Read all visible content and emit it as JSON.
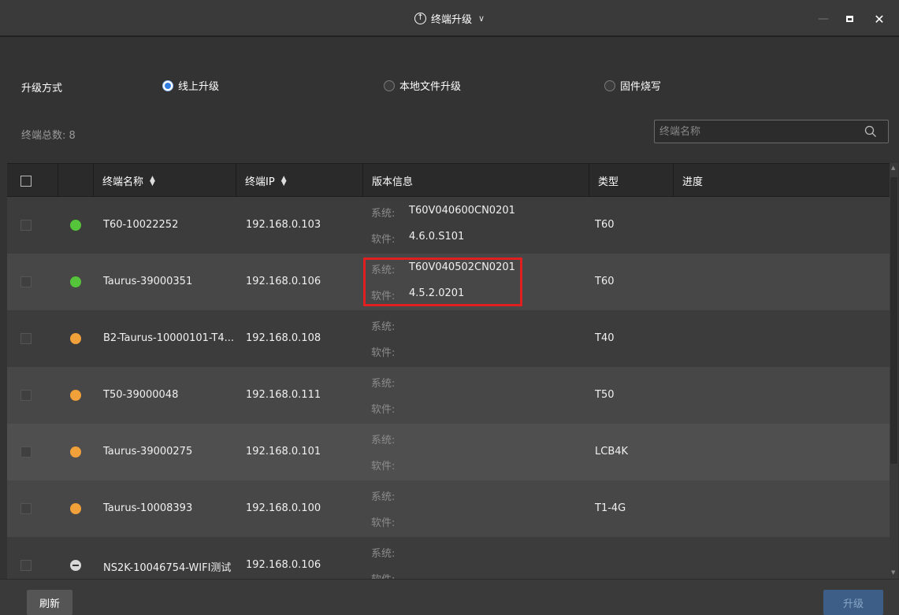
{
  "window": {
    "title": "终端升级",
    "minimize": "—",
    "close": "✕"
  },
  "mode": {
    "label": "升级方式",
    "options": [
      {
        "label": "线上升级",
        "checked": true
      },
      {
        "label": "本地文件升级",
        "checked": false
      },
      {
        "label": "固件烧写",
        "checked": false
      }
    ]
  },
  "summary": {
    "count_label": "终端总数: 8"
  },
  "search": {
    "placeholder": "终端名称"
  },
  "table": {
    "headers": {
      "name": "终端名称",
      "ip": "终端IP",
      "version": "版本信息",
      "type": "类型",
      "progress": "进度"
    },
    "version_labels": {
      "system": "系统:",
      "software": "软件:"
    },
    "rows": [
      {
        "status": "online",
        "name": "T60-10022252",
        "ip": "192.168.0.103",
        "system": "T60V040600CN0201",
        "software": "4.6.0.S101",
        "type": "T60"
      },
      {
        "status": "online",
        "name": "Taurus-39000351",
        "ip": "192.168.0.106",
        "system": "T60V040502CN0201",
        "software": "4.5.2.0201",
        "type": "T60"
      },
      {
        "status": "warning",
        "name": "B2-Taurus-10000101-T4...",
        "ip": "192.168.0.108",
        "system": "",
        "software": "",
        "type": "T40"
      },
      {
        "status": "warning",
        "name": "T50-39000048",
        "ip": "192.168.0.111",
        "system": "",
        "software": "",
        "type": "T50"
      },
      {
        "status": "warning",
        "name": "Taurus-39000275",
        "ip": "192.168.0.101",
        "system": "",
        "software": "",
        "type": "LCB4K"
      },
      {
        "status": "warning",
        "name": "Taurus-10008393",
        "ip": "192.168.0.100",
        "system": "",
        "software": "",
        "type": "T1-4G"
      },
      {
        "status": "offline",
        "name": "NS2K-10046754-WIFI测试",
        "ip": "192.168.0.106",
        "system": "",
        "software": "",
        "type": ""
      }
    ]
  },
  "footer": {
    "refresh_label": "刷新",
    "upgrade_label": "升级"
  },
  "colors": {
    "accent": "#2f7be0",
    "online": "#55c43a",
    "warning": "#f2a03a",
    "highlight": "#e02020"
  }
}
